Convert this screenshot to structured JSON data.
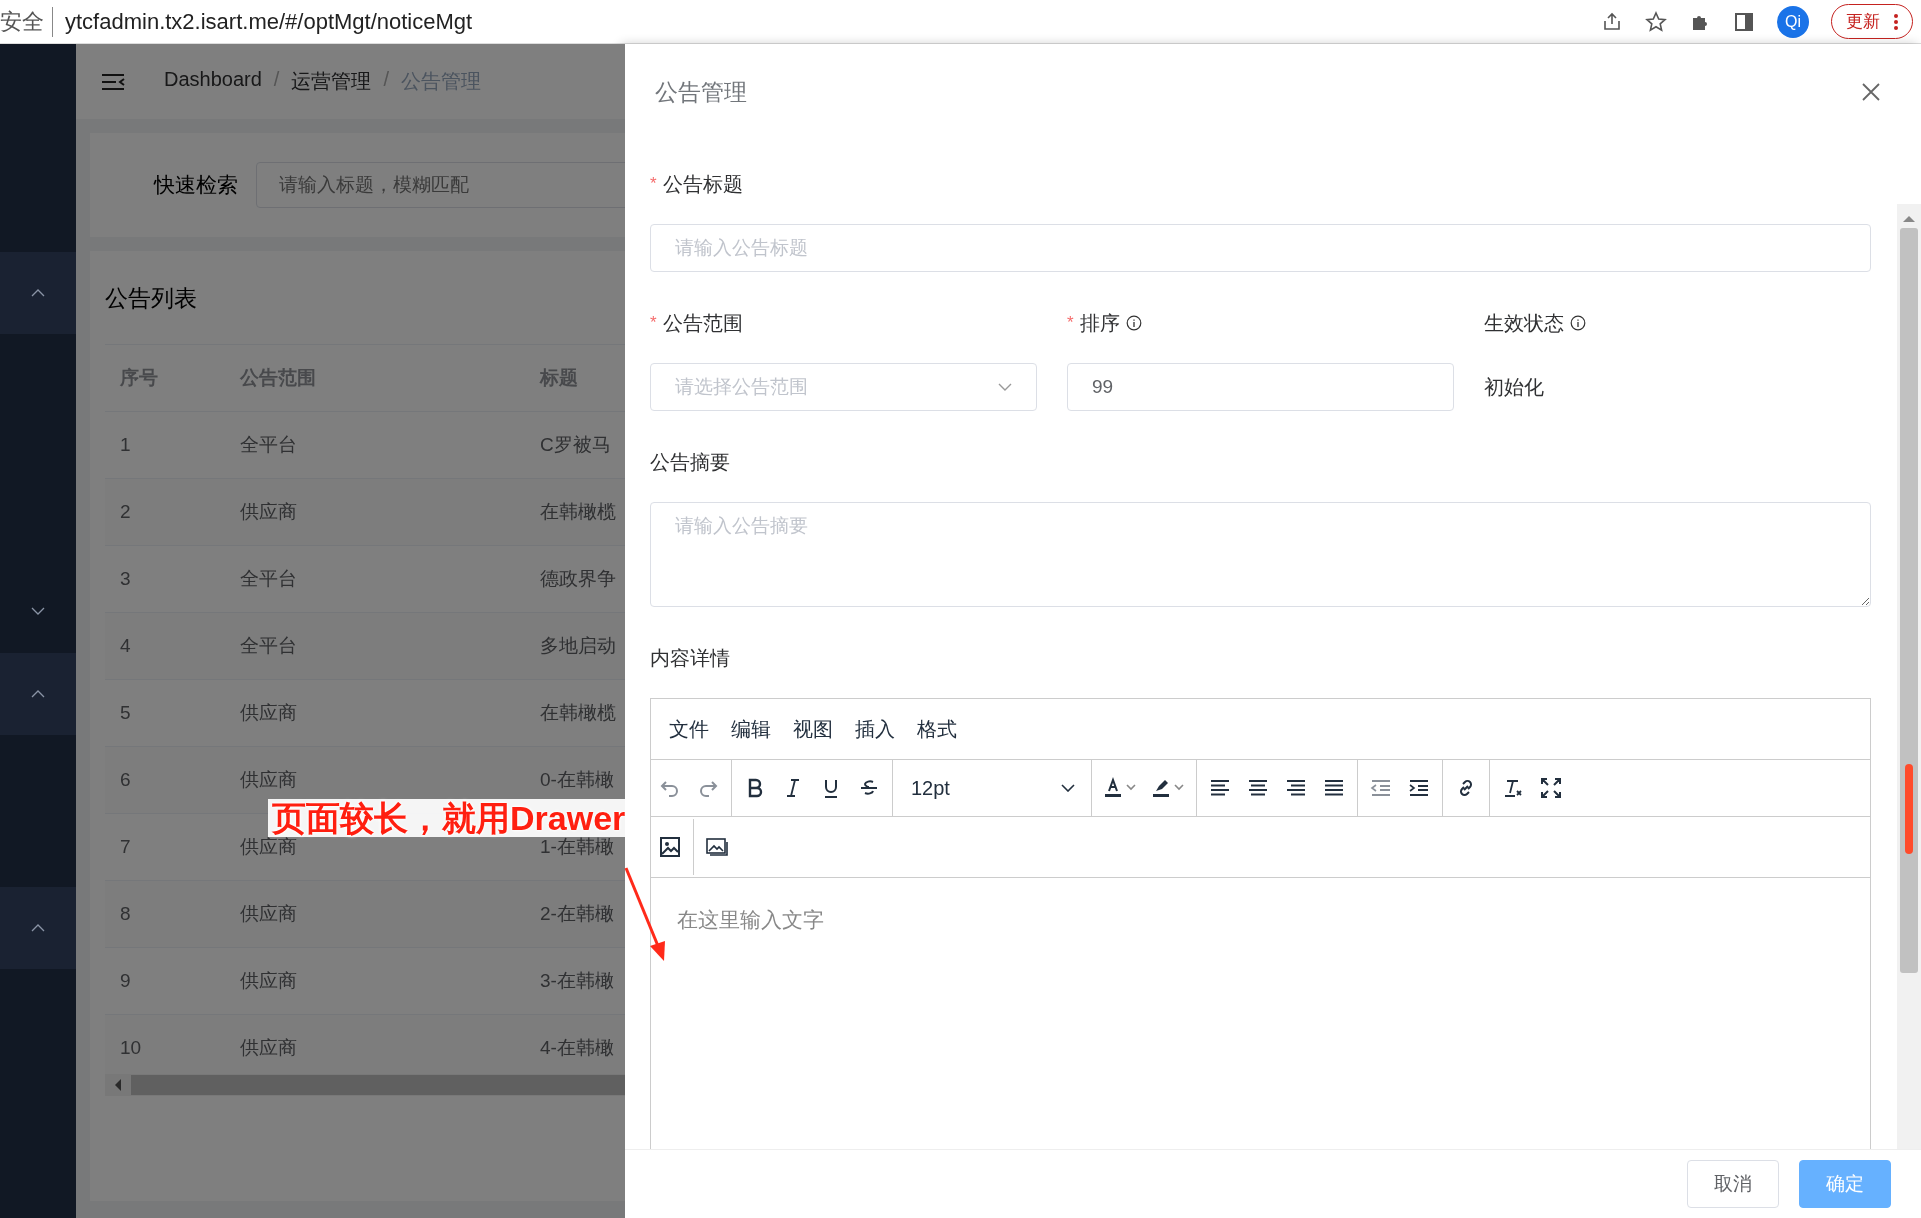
{
  "browser": {
    "security_label": "安全",
    "url": "ytcfadmin.tx2.isart.me/#/optMgt/noticeMgt",
    "profile": "Qi",
    "update_button": "更新"
  },
  "sidebar": {
    "groups": [
      {
        "expanded": true
      },
      {
        "expanded": false
      },
      {
        "expanded": true
      },
      {
        "expanded": true
      }
    ]
  },
  "main": {
    "breadcrumb": [
      {
        "label": "Dashboard"
      },
      {
        "separator": "/",
        "label": "运营管理"
      },
      {
        "separator": "/",
        "label": "公告管理"
      }
    ],
    "search": {
      "label": "快速检索",
      "placeholder": "请输入标题，模糊匹配"
    },
    "list_title": "公告列表",
    "table": {
      "columns": [
        "序号",
        "公告范围",
        "标题"
      ],
      "rows": [
        [
          "1",
          "全平台",
          "C罗被马"
        ],
        [
          "2",
          "供应商",
          "在韩橄榄"
        ],
        [
          "3",
          "全平台",
          "德政界争"
        ],
        [
          "4",
          "全平台",
          "多地启动"
        ],
        [
          "5",
          "供应商",
          "在韩橄榄"
        ],
        [
          "6",
          "供应商",
          "0-在韩橄"
        ],
        [
          "7",
          "供应商",
          "1-在韩橄"
        ],
        [
          "8",
          "供应商",
          "2-在韩橄"
        ],
        [
          "9",
          "供应商",
          "3-在韩橄"
        ],
        [
          "10",
          "供应商",
          "4-在韩橄"
        ]
      ]
    }
  },
  "drawer": {
    "title": "公告管理",
    "title_field": {
      "required_mark": "*",
      "label": "公告标题",
      "placeholder": "请输入公告标题"
    },
    "scope_field": {
      "required_mark": "*",
      "label": "公告范围",
      "placeholder": "请选择公告范围"
    },
    "order_field": {
      "required_mark": "*",
      "label": "排序",
      "info": true,
      "value": "99"
    },
    "status_field": {
      "label": "生效状态",
      "info": true,
      "value": "初始化"
    },
    "summary_field": {
      "label": "公告摘要",
      "placeholder": "请输入公告摘要"
    },
    "content_label": "内容详情",
    "editor": {
      "menu": [
        "文件",
        "编辑",
        "视图",
        "插入",
        "格式"
      ],
      "toolbar": [
        {
          "kind": "undo",
          "disabled": true
        },
        {
          "kind": "redo",
          "disabled": true
        },
        {
          "kind": "sep"
        },
        {
          "kind": "bold",
          "disabled": false
        },
        {
          "kind": "italic",
          "disabled": false
        },
        {
          "kind": "underline",
          "disabled": false
        },
        {
          "kind": "strike",
          "disabled": false
        },
        {
          "kind": "sep"
        },
        {
          "kind": "fontsize",
          "value": "12pt"
        },
        {
          "kind": "sep"
        },
        {
          "kind": "color",
          "disabled": false
        },
        {
          "kind": "highlight",
          "disabled": false
        },
        {
          "kind": "sep"
        },
        {
          "kind": "align-left",
          "disabled": false
        },
        {
          "kind": "align-center",
          "disabled": false
        },
        {
          "kind": "align-right",
          "disabled": false
        },
        {
          "kind": "justify",
          "disabled": false
        },
        {
          "kind": "sep"
        },
        {
          "kind": "outdent",
          "disabled": true
        },
        {
          "kind": "indent",
          "disabled": false
        },
        {
          "kind": "sep"
        },
        {
          "kind": "link",
          "disabled": false
        },
        {
          "kind": "sep"
        },
        {
          "kind": "clear",
          "disabled": false
        },
        {
          "kind": "fullscreen",
          "disabled": false
        }
      ],
      "toolbar_row2": [
        {
          "kind": "image",
          "disabled": false
        },
        {
          "kind": "sep"
        },
        {
          "kind": "gallery",
          "disabled": false
        }
      ],
      "placeholder": "在这里输入文字"
    },
    "buttons": [
      {
        "label": "取消",
        "primary": false
      },
      {
        "label": "确定",
        "primary": true
      }
    ]
  },
  "annotation": {
    "text": "页面较长，就用Drawer"
  }
}
